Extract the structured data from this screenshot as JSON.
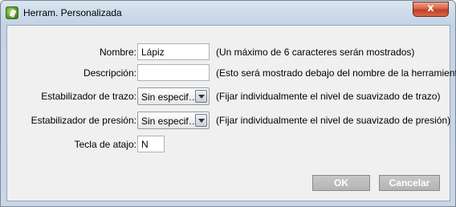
{
  "window": {
    "title": "Herram. Personalizada",
    "close_glyph": "x",
    "icon": "app-logo-icon"
  },
  "form": {
    "name": {
      "label": "Nombre:",
      "value": "Lápiz",
      "hint": "(Un máximo de 6 caracteres serán mostrados)"
    },
    "description": {
      "label": "Descripción:",
      "value": "",
      "hint": "(Esto será mostrado debajo del nombre de la herramienta)"
    },
    "stroke_stabilizer": {
      "label": "Estabilizador de trazo:",
      "selected": "Sin especif…",
      "hint": "(Fijar individualmente el nivel de suavizado de trazo)"
    },
    "pressure_stabilizer": {
      "label": "Estabilizador de presión:",
      "selected": "Sin especif…",
      "hint": "(Fijar individualmente el nivel de suavizado de presión)"
    },
    "shortcut": {
      "label": "Tecla de atajo:",
      "value": "N"
    }
  },
  "buttons": {
    "ok": "OK",
    "cancel": "Cancelar"
  },
  "colors": {
    "title_gradient_top": "#dbe6f1",
    "close_red": "#c23d22",
    "disabled_button": "#b4b4b4",
    "dialog_background": "#f0f0f0"
  }
}
